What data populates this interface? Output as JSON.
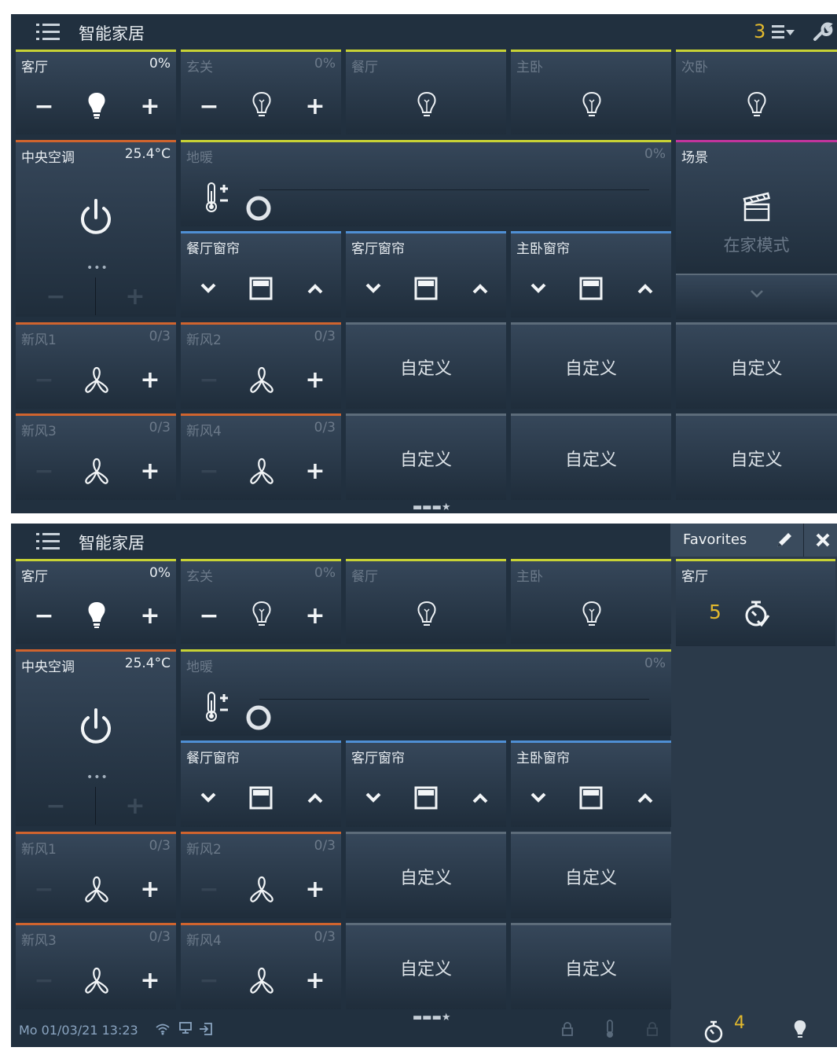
{
  "app_title": "智能家居",
  "screen1": {
    "notifications_count": "3",
    "tiles": {
      "living_light": {
        "name": "客厅",
        "value": "0%"
      },
      "entry_light": {
        "name": "玄关",
        "value": "0%"
      },
      "dining_light": {
        "name": "餐厅"
      },
      "master_light": {
        "name": "主卧"
      },
      "second_light": {
        "name": "次卧"
      },
      "ac": {
        "name": "中央空调",
        "value": "25.4°C"
      },
      "floor_heat": {
        "name": "地暖",
        "value": "0%"
      },
      "scene": {
        "name": "场景",
        "mode": "在家模式"
      },
      "dining_curtain": {
        "name": "餐厅窗帘"
      },
      "living_curtain": {
        "name": "客厅窗帘"
      },
      "master_curtain": {
        "name": "主卧窗帘"
      },
      "fan1": {
        "name": "新风1",
        "value": "0/3"
      },
      "fan2": {
        "name": "新风2",
        "value": "0/3"
      },
      "fan3": {
        "name": "新风3",
        "value": "0/3"
      },
      "fan4": {
        "name": "新风4",
        "value": "0/3"
      },
      "custom_label": "自定义"
    }
  },
  "screen2": {
    "favorites": {
      "title": "Favorites",
      "item_name": "客厅",
      "item_count": "5"
    },
    "status": {
      "datetime": "Mo 01/03/21   13:23",
      "timer_count": "4"
    }
  },
  "colors": {
    "accent_yellow": "#e2b92e",
    "bar_yellow": "#c8d235",
    "bar_orange": "#d0642e",
    "bar_blue": "#4f8fd4",
    "bar_magenta": "#c2349c"
  }
}
